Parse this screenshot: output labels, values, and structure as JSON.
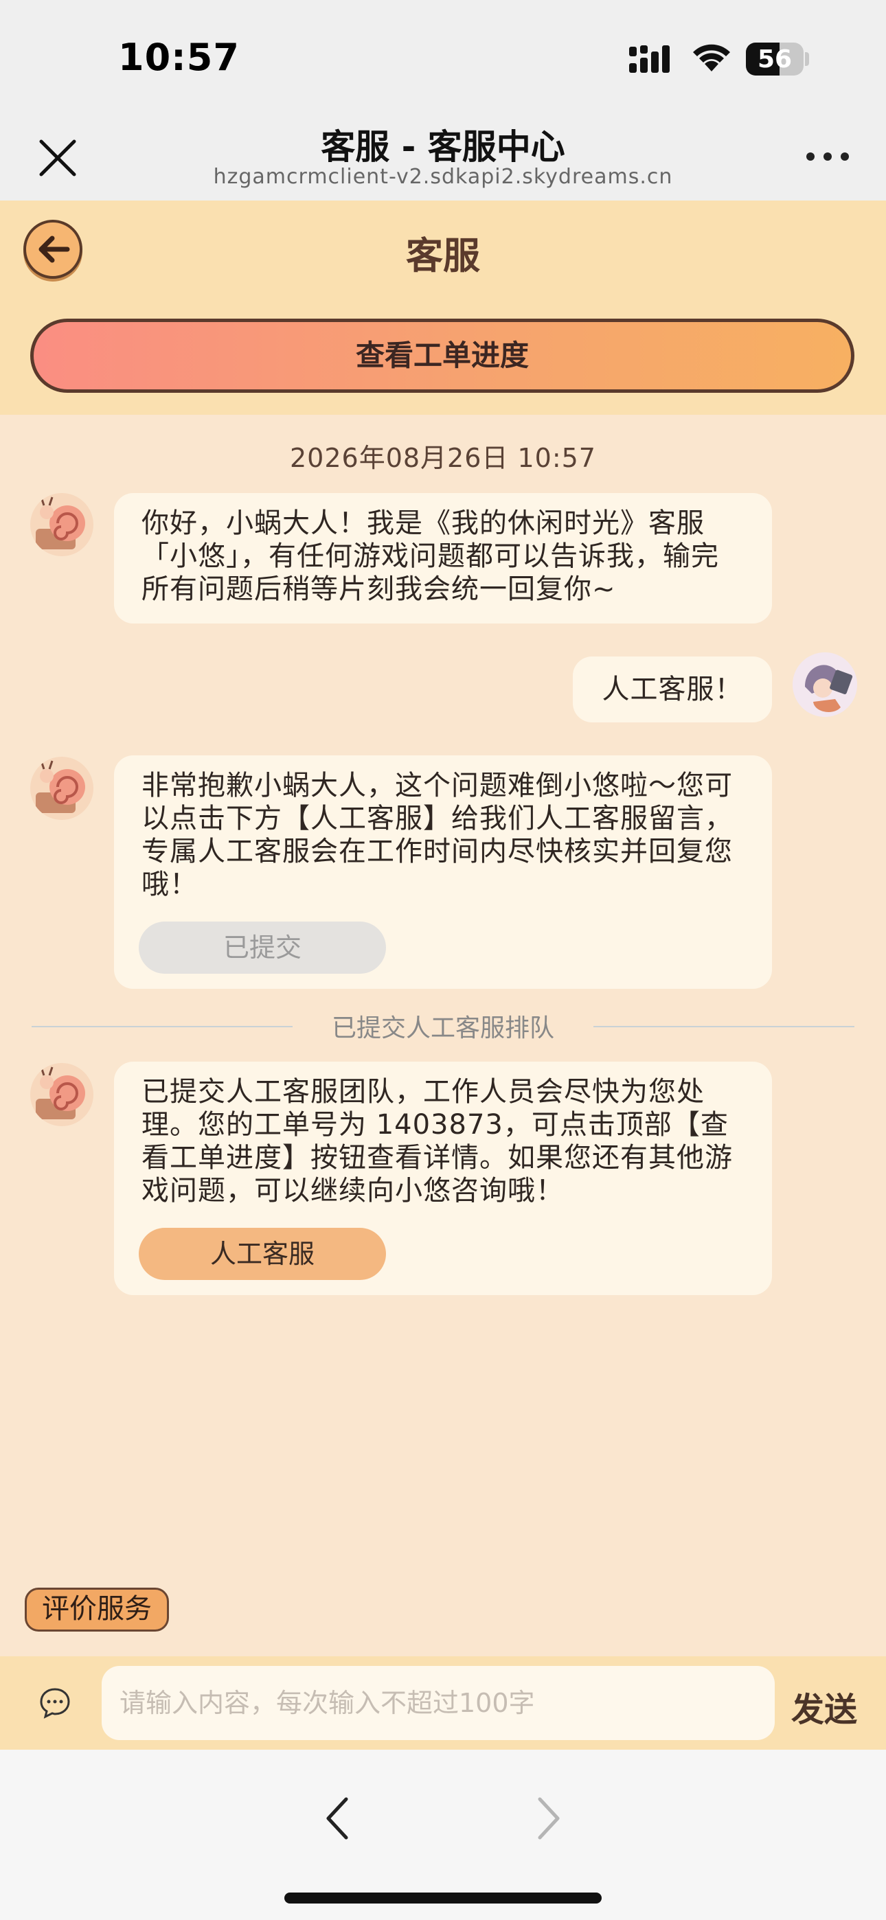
{
  "status_bar": {
    "time": "10:57",
    "battery": "56"
  },
  "browser": {
    "title": "客服 - 客服中心",
    "url": "hzgamcrmclient-v2.sdkapi2.skydreams.cn"
  },
  "header": {
    "title": "客服",
    "progress_button": "查看工单进度"
  },
  "chat": {
    "timestamp": "2026年08月26日 10:57",
    "messages": [
      {
        "from": "bot",
        "text": "你好，小蜗大人！我是《我的休闲时光》客服「小悠」，有任何游戏问题都可以告诉我，输完所有问题后稍等片刻我会统一回复你~"
      },
      {
        "from": "user",
        "text": "人工客服！"
      },
      {
        "from": "bot",
        "text": "非常抱歉小蜗大人，这个问题难倒小悠啦～您可以点击下方【人工客服】给我们人工客服留言，专属人工客服会在工作时间内尽快核实并回复您哦！",
        "button": "已提交"
      },
      {
        "from": "bot",
        "text": "已提交人工客服团队，工作人员会尽快为您处理。您的工单号为 1403873，可点击顶部【查看工单进度】按钮查看详情。如果您还有其他游戏问题，可以继续向小悠咨询哦！",
        "button": "人工客服"
      }
    ],
    "divider_label": "已提交人工客服排队"
  },
  "rate_button": "评价服务",
  "input": {
    "placeholder": "请输入内容，每次输入不超过100字",
    "value": "",
    "send_label": "发送"
  },
  "colors": {
    "page_bg": "#FAE6CF",
    "header_bg": "#FAE0B0",
    "bubble_bg": "#FEF6E7",
    "accent_button": "#F4B881",
    "progress_gradient_start": "#FA8E82",
    "progress_gradient_end": "#F7B062"
  },
  "icons": {
    "close": "close-icon",
    "more": "more-icon",
    "back": "back-arrow-icon",
    "chat": "chat-bubble-icon",
    "nav_back": "chevron-left-icon",
    "nav_forward": "chevron-right-icon"
  }
}
